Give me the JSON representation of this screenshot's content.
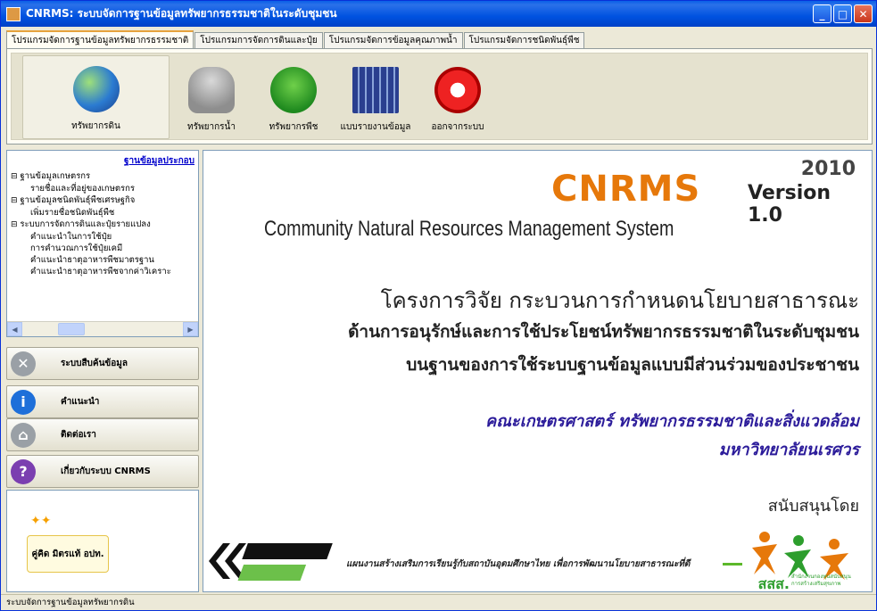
{
  "window": {
    "title": "CNRMS: ระบบจัดการฐานข้อมูลทรัพยากรธรรมชาติในระดับชุมชน",
    "minimize": "_",
    "maximize": "□",
    "close": "✕"
  },
  "tabs": [
    {
      "label": "โปรแกรมจัดการฐานข้อมูลทรัพยากรธรรมชาติ"
    },
    {
      "label": "โปรแกรมการจัดการดินและปุ๋ย"
    },
    {
      "label": "โปรแกรมจัดการข้อมูลคุณภาพน้ำ"
    },
    {
      "label": "โปรแกรมจัดการชนิดพันธุ์พืช"
    }
  ],
  "toolbar": [
    {
      "label": "ทรัพยากรดิน",
      "icon": "earth-icon"
    },
    {
      "label": "ทรัพยากรน้ำ",
      "icon": "rain-cloud-icon"
    },
    {
      "label": "ทรัพยากรพืช",
      "icon": "tree-icon"
    },
    {
      "label": "แบบรายงานข้อมูล",
      "icon": "bar-chart-icon"
    },
    {
      "label": "ออกจากระบบ",
      "icon": "power-icon"
    }
  ],
  "sidebar": {
    "title": "ฐานข้อมูลประกอบ",
    "tree": [
      {
        "label": "ฐานข้อมูลเกษตรกร",
        "children": [
          "รายชื่อและที่อยู่ของเกษตรกร"
        ]
      },
      {
        "label": "ฐานข้อมูลชนิดพันธุ์พืชเศรษฐกิจ",
        "children": [
          "เพิ่มรายชื่อชนิดพันธุ์พืช"
        ]
      },
      {
        "label": "ระบบการจัดการดินและปุ๋ยรายแปลง",
        "children": [
          "คำแนะนำในการใช้ปุ๋ย",
          "การคำนวณการใช้ปุ๋ยเคมี",
          "คำแนะนำธาตุอาหารพืชมาตรฐาน",
          "คำแนะนำธาตุอาหารพืชจากค่าวิเคราะ"
        ]
      }
    ],
    "scroll_left": "◀",
    "scroll_right": "▶",
    "nav": [
      {
        "label": "ระบบสืบค้นข้อมูล",
        "icon": "tools-icon",
        "glyph": "✕",
        "color": "#9aa0a6"
      },
      {
        "label": "คำแนะนำ",
        "icon": "info-icon",
        "glyph": "i",
        "color": "#1e6fd9"
      },
      {
        "label": "ติดต่อเรา",
        "icon": "home-icon",
        "glyph": "⌂",
        "color": "#9aa0a6"
      },
      {
        "label": "เกี่ยวกับระบบ CNRMS",
        "icon": "help-icon",
        "glyph": "?",
        "color": "#7b3fb0"
      }
    ],
    "logo_text": "คู่คิด มิตรแท้ อปท."
  },
  "main": {
    "year": "2010",
    "brand": "CNRMS",
    "version": "Version 1.0",
    "subtitle": "Community Natural Resources Management System",
    "line1": "โครงการวิจัย กระบวนการกำหนดนโยบายสาธารณะ",
    "line2": "ด้านการอนุรักษ์และการใช้ประโยชน์ทรัพยากรธรรมชาติในระดับชุมชน",
    "line3": "บนฐานของการใช้ระบบฐานข้อมูลแบบมีส่วนร่วมของประชาชน",
    "faculty": "คณะเกษตรศาสตร์ ทรัพยากรธรรมชาติและสิ่งแวดล้อม",
    "university": "มหาวิทยาลัยนเรศวร",
    "support_label": "สนับสนุนโดย",
    "network_text": "แผนงานสร้างเสริมการเรียนรู้กับสถาบันอุดมศึกษาไทย เพื่อการพัฒนานโยบายสาธารณะที่ดี",
    "sss": "สสส.",
    "sss_sub": "สำนักงานกองทุนสนับสนุนการสร้างเสริมสุขภาพ"
  },
  "status": "ระบบจัดการฐานข้อมูลทรัพยากรดิน"
}
